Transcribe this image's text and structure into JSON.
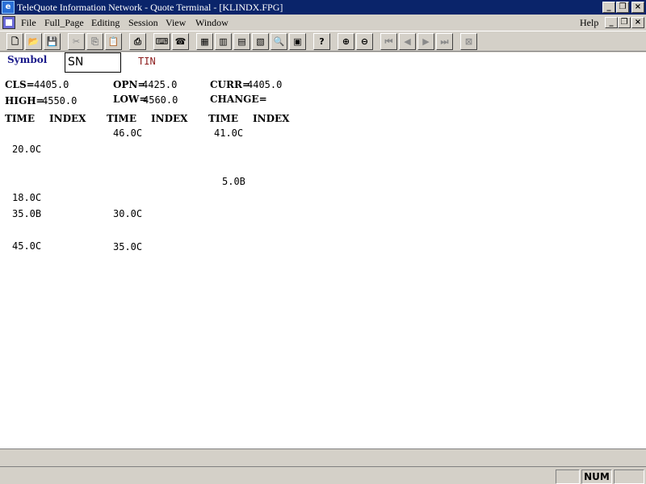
{
  "window": {
    "title": "TeleQuote Information Network - Quote Terminal - [KLINDX.FPG]",
    "controls": {
      "minimize": "_",
      "restore": "🗗",
      "close": "×"
    }
  },
  "menu": {
    "items": [
      "File",
      "Full_Page",
      "Editing",
      "Session",
      "View",
      "Window"
    ],
    "help": "Help"
  },
  "toolbar": {
    "buttons": [
      "new-file",
      "open-folder",
      "save",
      "cut",
      "copy",
      "paste",
      "print",
      "keyboard",
      "phone",
      "grid",
      "chart-1",
      "chart-2",
      "live",
      "zoom-search",
      "table",
      "help",
      "zoom-in",
      "zoom-out",
      "first",
      "previous",
      "next",
      "last",
      "close-box"
    ]
  },
  "quote": {
    "symbol_label": "Symbol",
    "symbol_value": "SN",
    "name": "TIN",
    "cls_label": "CLS=",
    "cls_value": "4405.0",
    "opn_label": "OPN=",
    "opn_value": "4425.0",
    "curr_label": "CURR=",
    "curr_value": "4405.0",
    "high_label": "HIGH=",
    "high_value": "4550.0",
    "low_label": "LOW=",
    "low_value": "4560.0",
    "change_label": "CHANGE=",
    "change_value": ""
  },
  "table": {
    "headers": [
      "TIME",
      "INDEX",
      "TIME",
      "INDEX",
      "TIME",
      "INDEX"
    ],
    "col1": [
      "20.0C",
      "18.0C",
      "35.0B",
      "45.0C"
    ],
    "col2": [
      "46.0C",
      "30.0C",
      "35.0C"
    ],
    "col3": [
      "41.0C",
      "5.0B"
    ]
  },
  "status": {
    "num": "NUM"
  }
}
